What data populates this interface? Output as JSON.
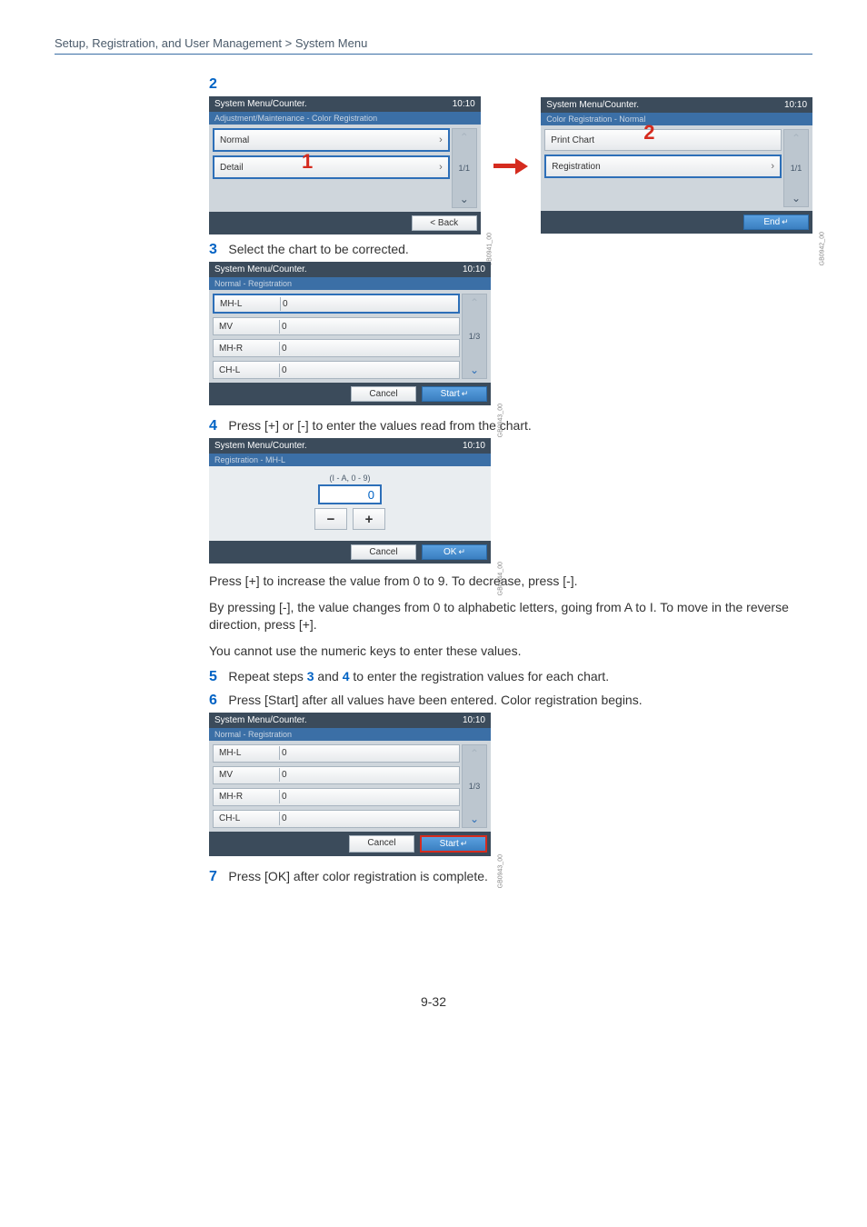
{
  "breadcrumb": "Setup, Registration, and User Management > System Menu",
  "marks": {
    "one": "1",
    "two_a": "2",
    "two_b": "2"
  },
  "panelA": {
    "title": "System Menu/Counter.",
    "time": "10:10",
    "sub": "Adjustment/Maintenance - Color Registration",
    "items": [
      {
        "label": "Normal"
      },
      {
        "label": "Detail"
      }
    ],
    "pager": "1/1",
    "back": "< Back",
    "side": "GB0941_00"
  },
  "panelB": {
    "title": "System Menu/Counter.",
    "time": "10:10",
    "sub": "Color Registration - Normal",
    "items": [
      {
        "label": "Print Chart"
      },
      {
        "label": "Registration"
      }
    ],
    "pager": "1/1",
    "end": "End",
    "side": "GB0942_00"
  },
  "step3": "Select the chart to be corrected.",
  "panelC": {
    "title": "System Menu/Counter.",
    "time": "10:10",
    "sub": "Normal - Registration",
    "rows": [
      {
        "k": "MH-L",
        "v": "0"
      },
      {
        "k": "MV",
        "v": "0"
      },
      {
        "k": "MH-R",
        "v": "0"
      },
      {
        "k": "CH-L",
        "v": "0"
      }
    ],
    "pager": "1/3",
    "cancel": "Cancel",
    "start": "Start",
    "side": "GB0943_00"
  },
  "step4": "Press [+] or [-] to enter the values read from the chart.",
  "panelD": {
    "title": "System Menu/Counter.",
    "time": "10:10",
    "sub": "Registration - MH-L",
    "range": "(I - A, 0 - 9)",
    "value": "0",
    "cancel": "Cancel",
    "ok": "OK",
    "side": "GB0944_00"
  },
  "para1": "Press [+] to increase the value from 0 to 9. To decrease, press [-].",
  "para2": "By pressing [-], the value changes from 0 to alphabetic letters, going from A to I. To move in the reverse direction, press [+].",
  "para3": "You cannot use the numeric keys to enter these values.",
  "step5": {
    "pre": "Repeat steps ",
    "r3": "3",
    "mid": " and ",
    "r4": "4",
    "post": " to enter the registration values for each chart."
  },
  "step6": "Press [Start] after all values have been entered. Color registration begins.",
  "panelE": {
    "title": "System Menu/Counter.",
    "time": "10:10",
    "sub": "Normal - Registration",
    "rows": [
      {
        "k": "MH-L",
        "v": "0"
      },
      {
        "k": "MV",
        "v": "0"
      },
      {
        "k": "MH-R",
        "v": "0"
      },
      {
        "k": "CH-L",
        "v": "0"
      }
    ],
    "pager": "1/3",
    "cancel": "Cancel",
    "start": "Start",
    "side": "GB0943_00"
  },
  "step7": "Press [OK] after color registration is complete.",
  "pagenum": "9-32",
  "stepnums": {
    "s3": "3",
    "s4": "4",
    "s5": "5",
    "s6": "6",
    "s7": "7"
  }
}
